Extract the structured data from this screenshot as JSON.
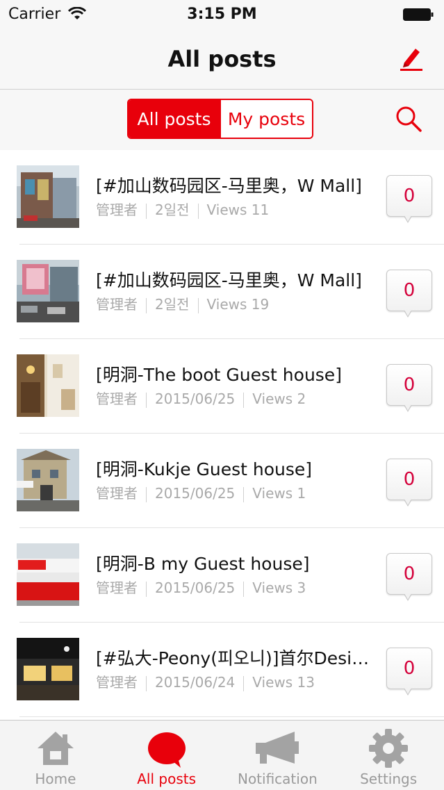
{
  "status_bar": {
    "carrier": "Carrier",
    "time": "3:15 PM"
  },
  "nav": {
    "title": "All posts"
  },
  "segments": {
    "all_posts": "All posts",
    "my_posts": "My posts"
  },
  "posts": [
    {
      "title": "[#加山数码园区-马里奥，W Mall]",
      "author": "管理者",
      "date": "2일전",
      "views": "Views 11",
      "comments": "0"
    },
    {
      "title": "[#加山数码园区-马里奥，W Mall]",
      "author": "管理者",
      "date": "2일전",
      "views": "Views 19",
      "comments": "0"
    },
    {
      "title": "[明洞-The boot  Guest house]",
      "author": "管理者",
      "date": "2015/06/25",
      "views": "Views 2",
      "comments": "0"
    },
    {
      "title": "[明洞-Kukje Guest house]",
      "author": "管理者",
      "date": "2015/06/25",
      "views": "Views 1",
      "comments": "0"
    },
    {
      "title": "[明洞-B my Guest house]",
      "author": "管理者",
      "date": "2015/06/25",
      "views": "Views 3",
      "comments": "0"
    },
    {
      "title": "[#弘大-Peony(피오니)]首尔Designer",
      "author": "管理者",
      "date": "2015/06/24",
      "views": "Views 13",
      "comments": "0"
    }
  ],
  "tabs": {
    "home": "Home",
    "all_posts": "All posts",
    "notification": "Notification",
    "settings": "Settings"
  },
  "colors": {
    "accent": "#e8000b",
    "comment_count": "#d4003a",
    "meta_text": "#a9a9a9",
    "inactive_tab": "#9a9a9a"
  }
}
